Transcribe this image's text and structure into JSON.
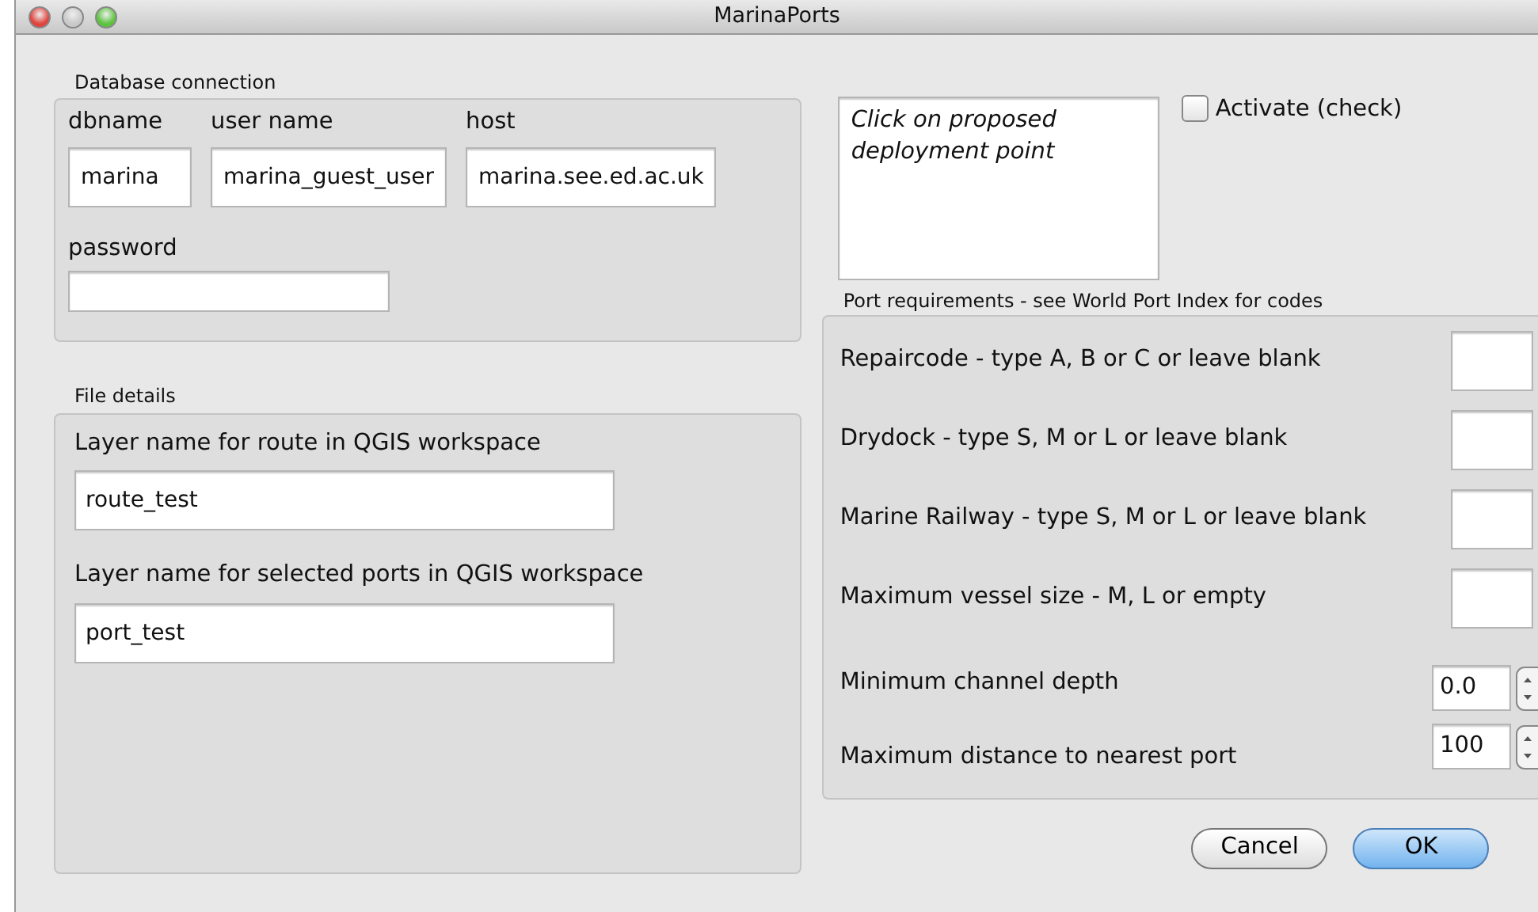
{
  "window": {
    "title": "MarinaPorts"
  },
  "database_connection": {
    "title": "Database connection",
    "fields": [
      {
        "label": "dbname",
        "value": "marina"
      },
      {
        "label": "user name",
        "value": "marina_guest_user"
      },
      {
        "label": "host",
        "value": "marina.see.ed.ac.uk"
      }
    ],
    "password": {
      "label": "password"
    }
  },
  "file_details": {
    "title": "File details",
    "fields": [
      {
        "label": "Layer name for route in QGIS workspace",
        "value": "route_test"
      },
      {
        "label": "Layer name for selected ports in QGIS workspace",
        "value": "port_test"
      }
    ]
  },
  "deployment_box": {
    "message": "Click on proposed deployment point"
  },
  "activate": {
    "label": "Activate (check)",
    "checked": false
  },
  "port_requirements": {
    "title": "Port requirements - see World Port Index for codes",
    "rows": [
      {
        "kind": "text",
        "label": "Repaircode - type A, B or C or leave blank"
      },
      {
        "kind": "text",
        "label": "Drydock - type S, M or L or leave blank"
      },
      {
        "kind": "text",
        "label": "Marine Railway - type S, M or L or leave blank"
      },
      {
        "kind": "text",
        "label": "Maximum vessel size - M, L or empty"
      },
      {
        "kind": "spin",
        "label": "Minimum channel depth",
        "value": "0.0"
      },
      {
        "kind": "spin",
        "label": "Maximum distance to nearest port",
        "value": "100"
      }
    ]
  },
  "buttons": [
    {
      "label": "Cancel",
      "default": false
    },
    {
      "label": "OK",
      "default": true
    }
  ]
}
